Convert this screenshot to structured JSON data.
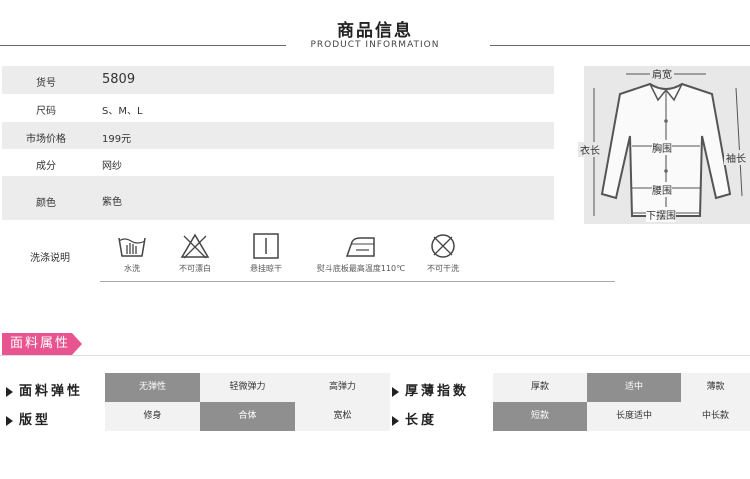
{
  "header": {
    "title": "商品信息",
    "subtitle": "PRODUCT INFORMATION"
  },
  "info": [
    {
      "label": "货号",
      "value": "5809"
    },
    {
      "label": "尺码",
      "value": "S、M、L"
    },
    {
      "label": "市场价格",
      "value": "199元"
    },
    {
      "label": "成分",
      "value": "网纱"
    },
    {
      "label": "颜色",
      "value": "紫色"
    }
  ],
  "care": {
    "label": "洗涤说明",
    "items": [
      {
        "icon": "hand-wash-icon",
        "text": "水洗"
      },
      {
        "icon": "no-bleach-icon",
        "text": "不可漂白"
      },
      {
        "icon": "hang-dry-icon",
        "text": "悬挂晾干"
      },
      {
        "icon": "iron-icon",
        "text": "熨斗底板最高温度110℃"
      },
      {
        "icon": "no-dry-clean-icon",
        "text": "不可干洗"
      }
    ]
  },
  "diagram": {
    "shoulder": "肩宽",
    "chest": "胸围",
    "waist": "腰围",
    "hem": "下摆围",
    "length": "衣长",
    "sleeve": "袖长"
  },
  "fabric": {
    "tag": "面料属性",
    "elasticity": {
      "label": "面料弹性",
      "options": [
        "无弹性",
        "轻微弹力",
        "高弹力"
      ],
      "selected": 0
    },
    "thickness": {
      "label": "厚薄指数",
      "options": [
        "厚款",
        "适中",
        "薄款"
      ],
      "selected": 1
    },
    "fit": {
      "label": "版型",
      "options": [
        "修身",
        "合体",
        "宽松"
      ],
      "selected": 1
    },
    "length": {
      "label": "长度",
      "options": [
        "短款",
        "长度适中",
        "中长款"
      ],
      "selected": 0
    }
  },
  "colors": {
    "accent": "#e8548f",
    "selected": "#8f8f8f",
    "shade": "#ececec"
  }
}
